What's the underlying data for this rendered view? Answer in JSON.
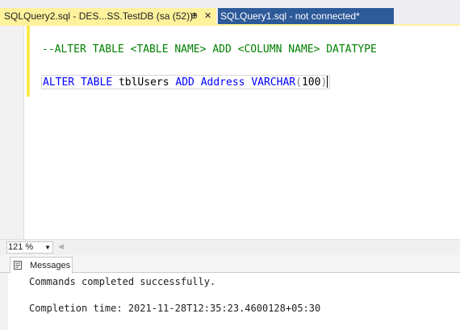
{
  "tabs": [
    {
      "label": "SQLQuery2.sql - DES...SS.TestDB (sa (52))*",
      "active": true,
      "pin_glyph": "⊕",
      "close_glyph": "✕"
    },
    {
      "label": "SQLQuery1.sql - not connected*",
      "active": false
    }
  ],
  "editor": {
    "comment_line": "--ALTER TABLE <TABLE NAME> ADD <COLUMN NAME> DATATYPE",
    "statement": {
      "kw_alter": "ALTER",
      "kw_table": "TABLE",
      "table_name": "tblUsers",
      "kw_add": "ADD",
      "column_name": "Address",
      "type": "VARCHAR",
      "paren_open": "(",
      "length": "100",
      "paren_close": ")"
    }
  },
  "zoom": {
    "value": "121 %"
  },
  "results": {
    "tab_label": "Messages",
    "messages": [
      "Commands completed successfully.",
      "Completion time: 2021-11-28T12:35:23.4600128+05:30"
    ]
  },
  "colors": {
    "active_tab": "#fff29d",
    "inactive_tab": "#2d5a99",
    "comment": "#008000",
    "keyword": "#0000ff",
    "function": "#ff00ff",
    "punctuation": "#808080"
  }
}
